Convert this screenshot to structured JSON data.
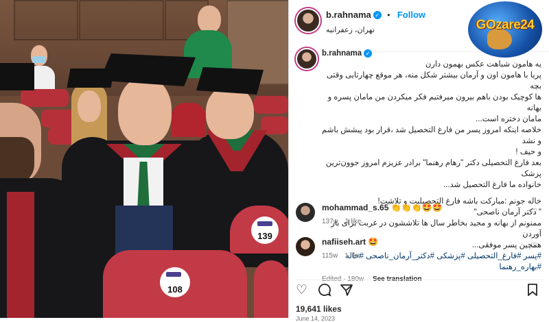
{
  "post": {
    "username": "b.rahnama",
    "follow_label": "Follow",
    "location": "تهران، زعفرانیه",
    "caption_lines": [
      "یه هامون شباهت عکس بهمون دارن",
      "پریا با هامون اون و آرمان بیشتر شکل منه، هر موقع چهارتایی وقتی بچه",
      "ها کوچیک بودن باهم بیرون میرفتیم فکر میکردن من مامان پسره و بهانه",
      "مامان دختره است...",
      "خلاصه اینکه امروز پسر من فارغ التحصیل شد ،قرار بود پیشش باشم و نشد",
      "و حیف !",
      "بعد فارغ التحصیلی دکتر \"رهام رهنما\" برادر عزیزم امروز جوون‌ترین پزشک",
      "خانواده ما فارغ التحصیل شد...",
      "",
      "خاله جونم :مبارکت باشه فارغ التحصیلیت و تلاشت!",
      "\" دکتر آرمان ناصحی\"",
      "ممنونم از بهانه و مجید بخاطر سال ها تلاششون در غربت برای بار آوردن",
      "همچین پسر موفقی..."
    ],
    "hashtags": "#پسر #فارغ_التحصیلی #پزشکی #دکتر_آرمان_ناصحی #خاله #بهاره_رهنما",
    "edited": "Edited · 180w",
    "translation_label": "See translation",
    "likes": "19,641 likes",
    "date": "June 14, 2023"
  },
  "comments": [
    {
      "username": "mohammad_s.65",
      "text": "👏👏👏🤩🤩",
      "age": "137w",
      "likes": "1 like"
    },
    {
      "username": "nafiiseh.art",
      "text": "🤩",
      "age": "115w",
      "likes": "1 like"
    }
  ],
  "watermark": {
    "text": "GOzare24"
  },
  "chairs": [
    {
      "number": "139"
    },
    {
      "number": "108"
    }
  ],
  "icons": {
    "like": "heart-icon",
    "comment": "comment-icon",
    "share": "send-icon",
    "save": "bookmark-icon",
    "more": "more-icon"
  },
  "colors": {
    "accent": "#0095f6",
    "hashtag": "#00376b",
    "muted": "#737373"
  }
}
